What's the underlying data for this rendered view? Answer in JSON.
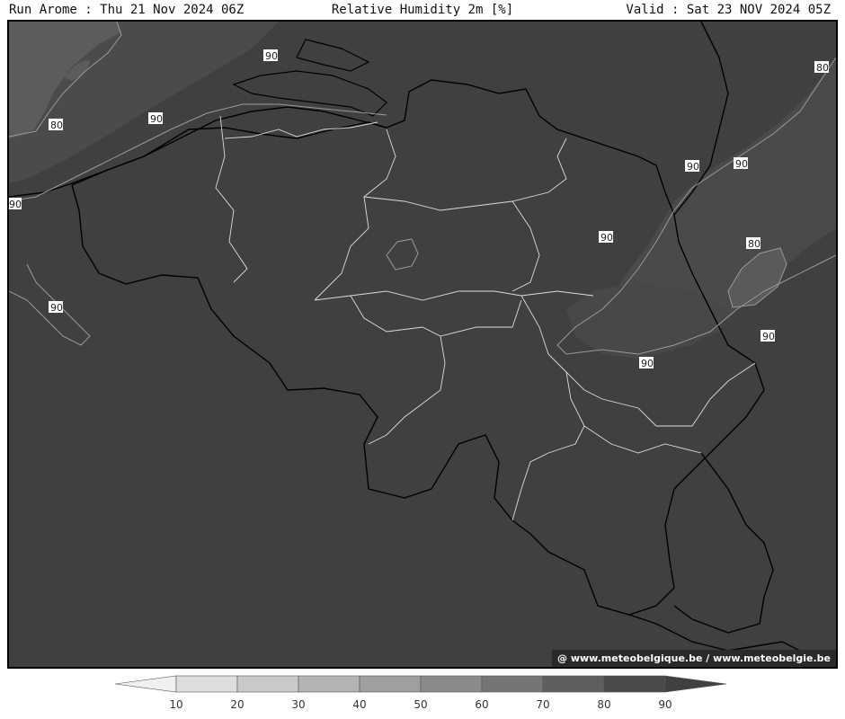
{
  "header": {
    "run_label": "Run Arome : Thu 21 Nov 2024 06Z",
    "title": "Relative Humidity 2m [%]",
    "valid_label": "Valid : Sat 23 NOV 2024 05Z"
  },
  "map": {
    "background_color": "#404040",
    "moist_area_color": "#4d4d4d",
    "dry_area_color": "#5e5e5e",
    "contour_labels": [
      "90",
      "80",
      "90",
      "90",
      "80",
      "90",
      "90",
      "90",
      "90",
      "80",
      "90",
      "90"
    ]
  },
  "credit": {
    "text": "@ www.meteobelgique.be / www.meteobelgie.be"
  },
  "legend": {
    "ticks": [
      "10",
      "20",
      "30",
      "40",
      "50",
      "60",
      "70",
      "80",
      "90"
    ],
    "colors": [
      "#f0f0f0",
      "#dedede",
      "#c9c9c9",
      "#b4b4b4",
      "#9f9f9f",
      "#8a8a8a",
      "#757575",
      "#5e5e5e",
      "#4a4a4a",
      "#404040"
    ]
  }
}
